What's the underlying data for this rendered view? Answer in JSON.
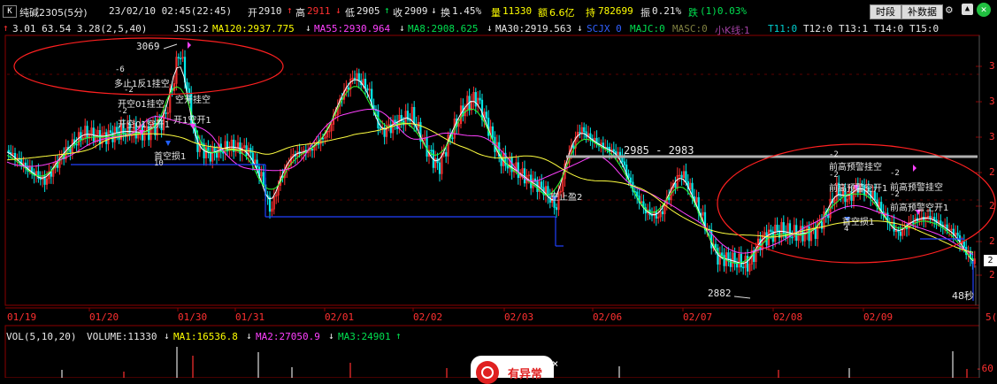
{
  "header": {
    "k_tag": "K",
    "symbol": "纯碱2305(5分)",
    "datetime": "23/02/10 02:45(22:45)",
    "open_label": "开",
    "open": "2910",
    "high_label": "高",
    "high": "2911",
    "low_label": "低",
    "low": "2905",
    "close_label": "收",
    "close": "2909",
    "turnover_label": "换",
    "turnover": "1.45%",
    "volume_label": "量",
    "volume": "11330",
    "amount_label": "额",
    "amount": "6.6亿",
    "position_label": "持",
    "position": "782699",
    "amplitude_label": "振",
    "amplitude": "0.21%",
    "change_label": "跌",
    "change": "(1)0.03%",
    "btn_timeshare": "时段",
    "btn_supplement": "补数据"
  },
  "legend": {
    "values": "3.01  63.54  3.28(2,5,40)",
    "jss": "JSS1:2",
    "ma120": "MA120:2937.775",
    "ma55": "MA55:2930.964",
    "ma8": "MA8:2908.625",
    "ma30": "MA30:2919.563",
    "scjx": "SCJX 0",
    "majc": "MAJC:0",
    "masc": "MASC:0",
    "xk": "小K线:1",
    "t11": "T11:0",
    "t12": "T12:0",
    "t13": "T13:1",
    "t14": "T14:0",
    "t15": "T15:0"
  },
  "annotations": {
    "high_price": "3069",
    "low_price": "2882",
    "range_text": "2985 - 2983",
    "countdown": "48秒",
    "sig_a_num": "-6",
    "sig_a": "多止1反1挂空",
    "sig_b_num": "-2",
    "sig_b": "开空01挂空",
    "sig_c_num": "-2",
    "sig_c": "开空01空开1",
    "sig_d": "首空损1",
    "sig_d_num": "10",
    "sig_e": "空开挂空",
    "sig_f": "开1空开1",
    "sig_g": "空止盈2",
    "sig_h_num": "-2",
    "sig_h": "前高预警挂空",
    "sig_i_num": "-2",
    "sig_i": "前高预警空开1",
    "sig_j_num": "-2",
    "sig_j": "前高预警挂空",
    "sig_k_num": "-2",
    "sig_k": "前高预警空开1",
    "sig_l": "首空损1",
    "sig_l_num": "4"
  },
  "right_axis": [
    "3",
    "3",
    "3",
    "2",
    "2",
    "2",
    "2"
  ],
  "current_price_tag": "2",
  "axis_end_label": "5(",
  "time_axis": [
    "01/19",
    "01/20",
    "01/30",
    "01/31",
    "02/01",
    "02/02",
    "02/03",
    "02/06",
    "02/07",
    "02/08",
    "02/09"
  ],
  "volume_header": {
    "title": "VOL(5,10,20)",
    "volume": "VOLUME:11330",
    "ma1": "MA1:16536.8",
    "ma2": "MA2:27050.9",
    "ma3": "MA3:24901"
  },
  "volume_axis_label": "-60",
  "popup_text": "有异常",
  "popup_close": "×",
  "colors": {
    "up": "#ff3030",
    "down": "#00e8e8",
    "ma_yellow": "#ffff40",
    "ma_magenta": "#ff40ff",
    "ma_green": "#30ff30",
    "ma_white": "#ffffff",
    "grid": "#8b0000",
    "support_blue": "#2040ff",
    "circle": "#ff2020"
  },
  "chart_data": {
    "type": "candlestick",
    "y_range": [
      2882,
      3069
    ],
    "marked_high": 3069,
    "marked_low": 2882,
    "resistance_band": [
      2983,
      2985
    ],
    "last_close": 2909
  }
}
